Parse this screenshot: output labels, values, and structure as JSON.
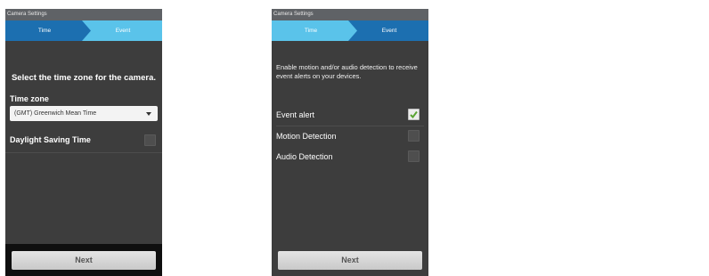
{
  "colors": {
    "step_active": "#1c6fb0",
    "step_inactive": "#5ac3ea",
    "screen_bg": "#3d3d3d",
    "check_green": "#5aa332"
  },
  "screen1": {
    "title": "Camera Settings",
    "steps": [
      "Time",
      "Event"
    ],
    "active_step": 0,
    "heading": "Select the time zone for the camera.",
    "timezone_label": "Time zone",
    "timezone_value": "(GMT) Greenwich Mean Time",
    "dst_label": "Daylight Saving Time",
    "dst_checked": false,
    "next_label": "Next"
  },
  "screen2": {
    "title": "Camera Settings",
    "steps": [
      "Time",
      "Event"
    ],
    "active_step": 1,
    "description": "Enable motion and/or audio detection to receive event alerts on your devices.",
    "options": [
      {
        "label": "Event alert",
        "checked": true
      },
      {
        "label": "Motion Detection",
        "checked": false
      },
      {
        "label": "Audio Detection",
        "checked": false
      }
    ],
    "next_label": "Next"
  }
}
